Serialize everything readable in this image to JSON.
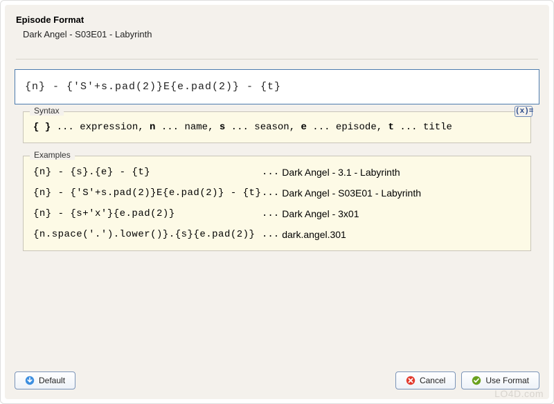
{
  "header": {
    "title": "Episode Format",
    "preview": "Dark Angel - S03E01 - Labyrinth"
  },
  "format_input": "{n} - {'S'+s.pad(2)}E{e.pad(2)} - {t}",
  "syntax": {
    "label": "Syntax",
    "badge": "(x)=",
    "brace": "{ }",
    "txt_expr": " ... expression, ",
    "n": "n",
    "txt_name": " ... name, ",
    "s": "s",
    "txt_season": " ... season, ",
    "e": "e",
    "txt_episode": " ... episode, ",
    "t": "t",
    "txt_title": " ... title"
  },
  "examples": {
    "label": "Examples",
    "rows": [
      {
        "expr": "{n} - {s}.{e} - {t}",
        "out": "Dark Angel - 3.1 - Labyrinth"
      },
      {
        "expr": "{n} - {'S'+s.pad(2)}E{e.pad(2)} - {t}",
        "out": "Dark Angel - S03E01 - Labyrinth"
      },
      {
        "expr": "{n} - {s+'x'}{e.pad(2)}",
        "out": "Dark Angel - 3x01"
      },
      {
        "expr": "{n.space('.').lower()}.{s}{e.pad(2)}",
        "out": "dark.angel.301"
      }
    ]
  },
  "buttons": {
    "default": "Default",
    "cancel": "Cancel",
    "use_format": "Use Format"
  },
  "watermark": "LO4D.com"
}
